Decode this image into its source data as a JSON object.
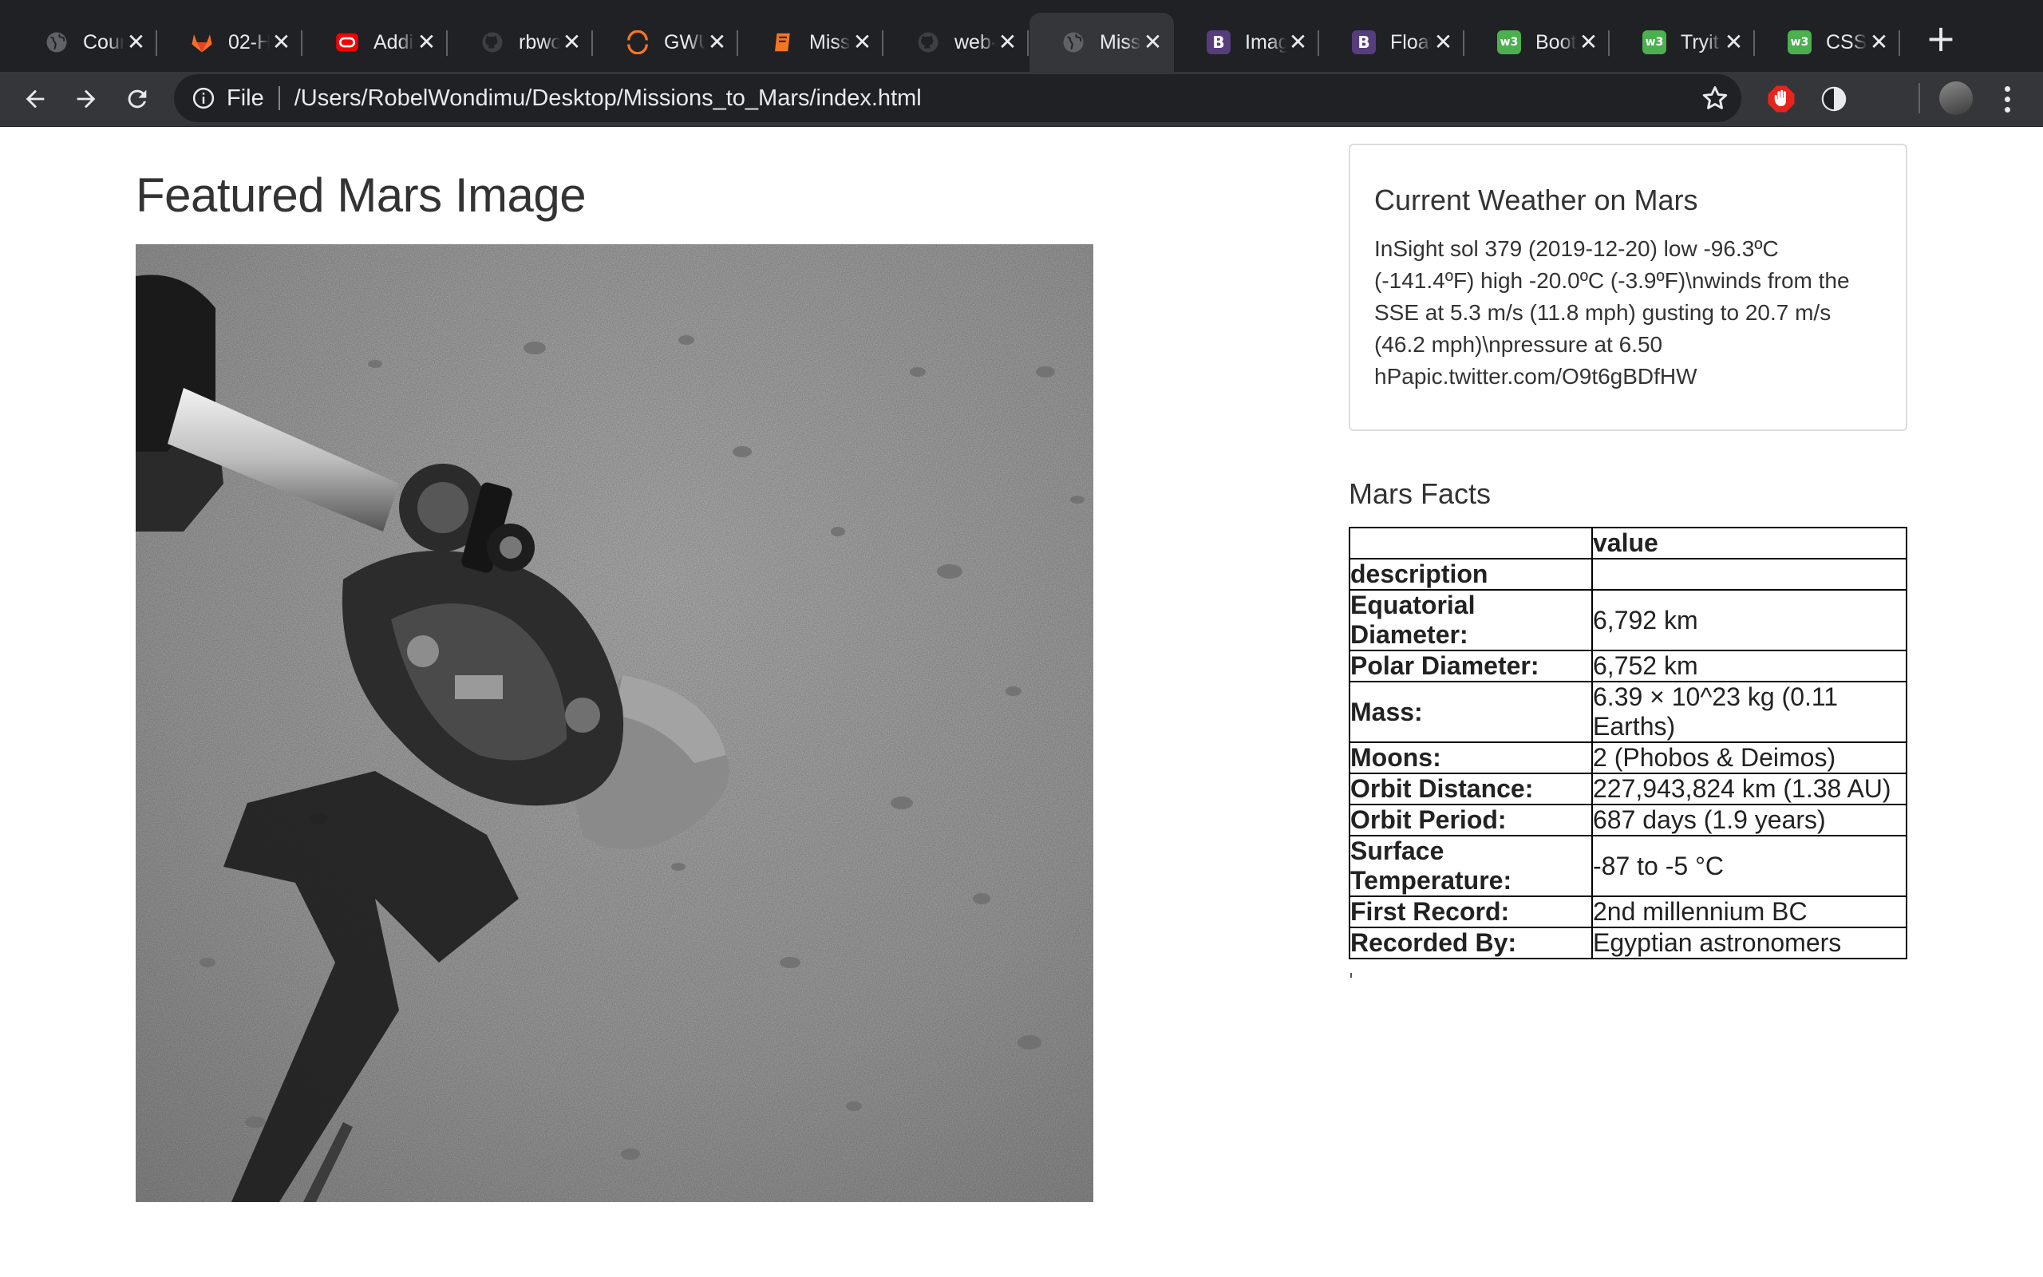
{
  "browser": {
    "tabs": [
      {
        "title": "Cour",
        "icon": "globe-icon",
        "color": "#5f6368",
        "active": false
      },
      {
        "title": "02-H",
        "icon": "gitlab-icon",
        "color": "#fc6d26",
        "active": false
      },
      {
        "title": "Addi",
        "icon": "oracle-icon",
        "color": "#f80000",
        "active": false
      },
      {
        "title": "rbwo",
        "icon": "github-icon",
        "color": "#9aa0a6",
        "active": false
      },
      {
        "title": "GWU",
        "icon": "circle-arc-icon",
        "color": "#f37626",
        "active": false
      },
      {
        "title": "Miss",
        "icon": "notebook-icon",
        "color": "#f37626",
        "active": false
      },
      {
        "title": "web-",
        "icon": "github-icon",
        "color": "#9aa0a6",
        "active": false
      },
      {
        "title": "Miss",
        "icon": "globe-icon",
        "color": "#5f6368",
        "active": true
      },
      {
        "title": "Imag",
        "icon": "bootstrap-icon",
        "color": "#563d7c",
        "active": false,
        "glyph": "B"
      },
      {
        "title": "Float",
        "icon": "bootstrap-icon",
        "color": "#563d7c",
        "active": false,
        "glyph": "B"
      },
      {
        "title": "Boot",
        "icon": "w3schools-icon",
        "color": "#4caf50",
        "active": false,
        "glyph": "w3"
      },
      {
        "title": "Tryit",
        "icon": "w3schools-icon",
        "color": "#4caf50",
        "active": false,
        "glyph": "w3"
      },
      {
        "title": "CSS",
        "icon": "w3schools-icon",
        "color": "#4caf50",
        "active": false,
        "glyph": "w3"
      }
    ],
    "close_glyph": "✕",
    "new_tab_glyph": "+",
    "omnibox": {
      "scheme": "File",
      "url": "/Users/RobelWondimu/Desktop/Missions_to_Mars/index.html"
    }
  },
  "page": {
    "featured": {
      "title": "Featured Mars Image"
    },
    "weather": {
      "title": "Current Weather on Mars",
      "text": "InSight sol 379 (2019-12-20) low -96.3ºC (-141.4ºF) high -20.0ºC (-3.9ºF)\\nwinds from the SSE at 5.3 m/s (11.8 mph) gusting to 20.7 m/s (46.2 mph)\\npressure at 6.50 hPapic.twitter.com/O9t6gBDfHW"
    },
    "facts": {
      "title": "Mars Facts",
      "header": [
        "",
        "value"
      ],
      "index_label": "description",
      "rows": [
        [
          "Equatorial Diameter:",
          "6,792 km"
        ],
        [
          "Polar Diameter:",
          "6,752 km"
        ],
        [
          "Mass:",
          "6.39 × 10^23 kg (0.11 Earths)"
        ],
        [
          "Moons:",
          "2 (Phobos & Deimos)"
        ],
        [
          "Orbit Distance:",
          "227,943,824 km (1.38 AU)"
        ],
        [
          "Orbit Period:",
          "687 days (1.9 years)"
        ],
        [
          "Surface Temperature:",
          "-87 to -5 °C"
        ],
        [
          "First Record:",
          "2nd millennium BC"
        ],
        [
          "Recorded By:",
          "Egyptian astronomers"
        ]
      ]
    }
  }
}
